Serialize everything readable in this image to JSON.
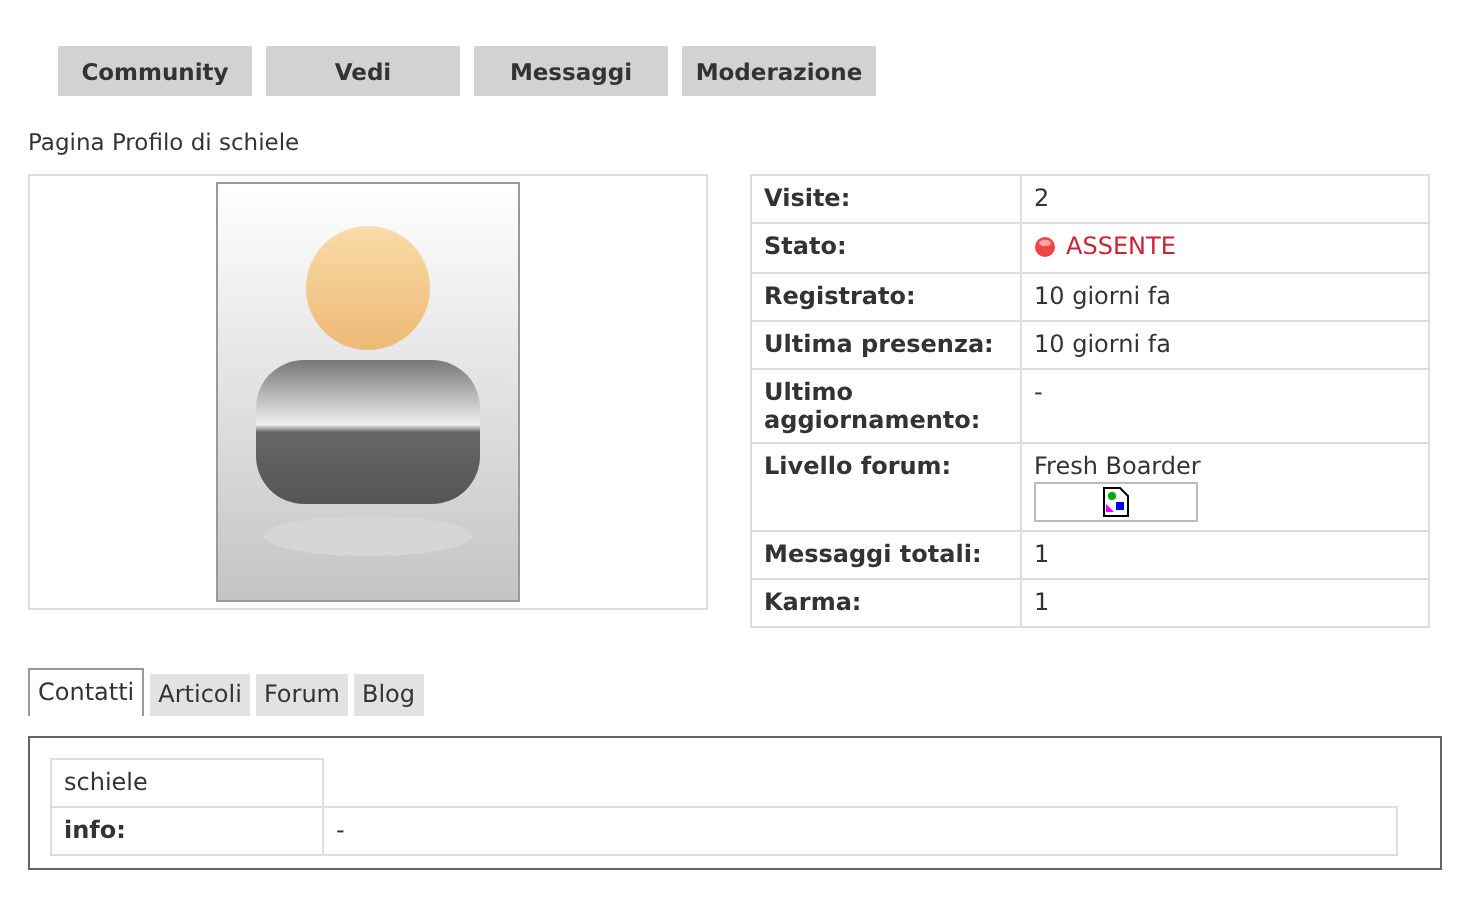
{
  "nav_buttons": [
    "Community",
    "Vedi",
    "Messaggi",
    "Moderazione"
  ],
  "page_title": "Pagina Profilo di schiele",
  "stats": [
    {
      "kind": "text",
      "label": "Visite:",
      "value": "2"
    },
    {
      "kind": "status",
      "label": "Stato:",
      "value": "ASSENTE",
      "online": false
    },
    {
      "kind": "text",
      "label": "Registrato:",
      "value": "10 giorni fa"
    },
    {
      "kind": "text",
      "label": "Ultima presenza:",
      "value": "10 giorni fa"
    },
    {
      "kind": "text",
      "label": "Ultimo aggiornamento:",
      "value": "-"
    },
    {
      "kind": "rank",
      "label": "Livello forum:",
      "value": "Fresh Boarder"
    },
    {
      "kind": "text",
      "label": "Messaggi totali:",
      "value": "1"
    },
    {
      "kind": "text",
      "label": "Karma:",
      "value": "1"
    }
  ],
  "tabs": [
    {
      "label": "Contatti",
      "selected": true
    },
    {
      "label": "Articoli",
      "selected": false
    },
    {
      "label": "Forum",
      "selected": false
    },
    {
      "label": "Blog",
      "selected": false
    }
  ],
  "contacts": {
    "name": "schiele",
    "rows": [
      {
        "label": "info:",
        "value": "-"
      }
    ]
  }
}
